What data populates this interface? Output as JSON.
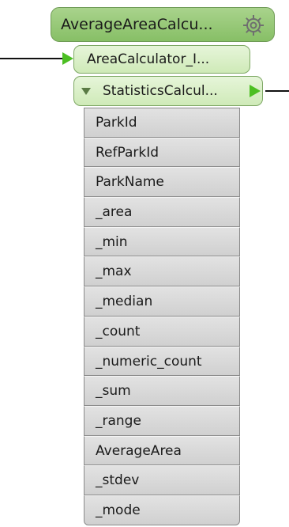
{
  "transformer": {
    "title": "AverageAreaCalcu...",
    "input_port_label": "AreaCalculator_I...",
    "output_port_label": "StatisticsCalcul..."
  },
  "icons": {
    "settings": "gear-icon",
    "expand": "triangle-down-icon"
  },
  "colors": {
    "transformer_fill": "#87bf66",
    "port_fill": "#d9efc6",
    "arrow": "#4cbf22",
    "attribute_fill": "#d9d9d9"
  },
  "attributes": [
    "ParkId",
    "RefParkId",
    "ParkName",
    "_area",
    "_min",
    "_max",
    "_median",
    "_count",
    "_numeric_count",
    "_sum",
    "_range",
    "AverageArea",
    "_stdev",
    "_mode"
  ]
}
